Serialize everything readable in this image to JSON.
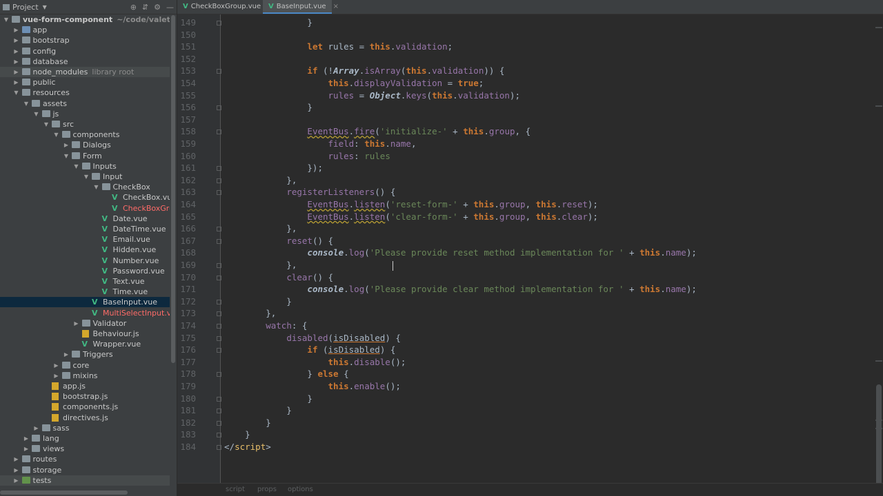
{
  "sidebar": {
    "title": "Project",
    "tree": [
      {
        "label": "vue-form-component",
        "sub": "~/code/valet/vue-fo",
        "depth": 0,
        "arrow": "down",
        "icon": "folder",
        "bold": true
      },
      {
        "label": "app",
        "depth": 1,
        "arrow": "right",
        "icon": "folder-blue"
      },
      {
        "label": "bootstrap",
        "depth": 1,
        "arrow": "right",
        "icon": "folder"
      },
      {
        "label": "config",
        "depth": 1,
        "arrow": "right",
        "icon": "folder"
      },
      {
        "label": "database",
        "depth": 1,
        "arrow": "right",
        "icon": "folder"
      },
      {
        "label": "node_modules",
        "sub": "library root",
        "depth": 1,
        "arrow": "right",
        "icon": "folder",
        "hl": true
      },
      {
        "label": "public",
        "depth": 1,
        "arrow": "right",
        "icon": "folder"
      },
      {
        "label": "resources",
        "depth": 1,
        "arrow": "down",
        "icon": "folder"
      },
      {
        "label": "assets",
        "depth": 2,
        "arrow": "down",
        "icon": "folder"
      },
      {
        "label": "js",
        "depth": 3,
        "arrow": "down",
        "icon": "folder"
      },
      {
        "label": "src",
        "depth": 4,
        "arrow": "down",
        "icon": "folder"
      },
      {
        "label": "components",
        "depth": 5,
        "arrow": "down",
        "icon": "folder"
      },
      {
        "label": "Dialogs",
        "depth": 6,
        "arrow": "right",
        "icon": "folder"
      },
      {
        "label": "Form",
        "depth": 6,
        "arrow": "down",
        "icon": "folder"
      },
      {
        "label": "Inputs",
        "depth": 7,
        "arrow": "down",
        "icon": "folder"
      },
      {
        "label": "Input",
        "depth": 8,
        "arrow": "down",
        "icon": "folder"
      },
      {
        "label": "CheckBox",
        "depth": 9,
        "arrow": "down",
        "icon": "folder"
      },
      {
        "label": "CheckBox.vue",
        "depth": 10,
        "icon": "vue"
      },
      {
        "label": "CheckBoxGro",
        "depth": 10,
        "icon": "vue",
        "red": true
      },
      {
        "label": "Date.vue",
        "depth": 9,
        "icon": "vue"
      },
      {
        "label": "DateTime.vue",
        "depth": 9,
        "icon": "vue"
      },
      {
        "label": "Email.vue",
        "depth": 9,
        "icon": "vue"
      },
      {
        "label": "Hidden.vue",
        "depth": 9,
        "icon": "vue"
      },
      {
        "label": "Number.vue",
        "depth": 9,
        "icon": "vue"
      },
      {
        "label": "Password.vue",
        "depth": 9,
        "icon": "vue"
      },
      {
        "label": "Text.vue",
        "depth": 9,
        "icon": "vue"
      },
      {
        "label": "Time.vue",
        "depth": 9,
        "icon": "vue"
      },
      {
        "label": "BaseInput.vue",
        "depth": 8,
        "icon": "vue",
        "selected": true
      },
      {
        "label": "MultiSelectInput.vue",
        "depth": 8,
        "icon": "vue",
        "red": true
      },
      {
        "label": "Validator",
        "depth": 7,
        "arrow": "right",
        "icon": "folder"
      },
      {
        "label": "Behaviour.js",
        "depth": 7,
        "icon": "js"
      },
      {
        "label": "Wrapper.vue",
        "depth": 7,
        "icon": "vue"
      },
      {
        "label": "Triggers",
        "depth": 6,
        "arrow": "right",
        "icon": "folder"
      },
      {
        "label": "core",
        "depth": 5,
        "arrow": "right",
        "icon": "folder"
      },
      {
        "label": "mixins",
        "depth": 5,
        "arrow": "right",
        "icon": "folder"
      },
      {
        "label": "app.js",
        "depth": 4,
        "icon": "js"
      },
      {
        "label": "bootstrap.js",
        "depth": 4,
        "icon": "js"
      },
      {
        "label": "components.js",
        "depth": 4,
        "icon": "js"
      },
      {
        "label": "directives.js",
        "depth": 4,
        "icon": "js"
      },
      {
        "label": "sass",
        "depth": 3,
        "arrow": "right",
        "icon": "folder"
      },
      {
        "label": "lang",
        "depth": 2,
        "arrow": "right",
        "icon": "folder"
      },
      {
        "label": "views",
        "depth": 2,
        "arrow": "right",
        "icon": "folder"
      },
      {
        "label": "routes",
        "depth": 1,
        "arrow": "right",
        "icon": "folder"
      },
      {
        "label": "storage",
        "depth": 1,
        "arrow": "right",
        "icon": "folder"
      },
      {
        "label": "tests",
        "depth": 1,
        "arrow": "right",
        "icon": "folder-green",
        "hl2": true
      }
    ]
  },
  "tabs": [
    {
      "label": "CheckBoxGroup.vue",
      "active": false
    },
    {
      "label": "BaseInput.vue",
      "active": true
    }
  ],
  "code": [
    {
      "n": "149",
      "t": [
        [
          "                }",
          "punc"
        ]
      ]
    },
    {
      "n": "150",
      "t": []
    },
    {
      "n": "151",
      "t": [
        [
          "                ",
          ""
        ],
        [
          "let",
          "kw"
        ],
        [
          " rules = ",
          ""
        ],
        [
          "this",
          "kw"
        ],
        [
          ".",
          ""
        ],
        [
          "validation",
          "prop"
        ],
        [
          ";",
          ""
        ]
      ]
    },
    {
      "n": "152",
      "t": []
    },
    {
      "n": "153",
      "t": [
        [
          "                ",
          ""
        ],
        [
          "if",
          "kw"
        ],
        [
          " (!",
          ""
        ],
        [
          "Array",
          "glob"
        ],
        [
          ".",
          ""
        ],
        [
          "isArray",
          "prop"
        ],
        [
          "(",
          ""
        ],
        [
          "this",
          "kw"
        ],
        [
          ".",
          ""
        ],
        [
          "validation",
          "prop"
        ],
        [
          ")) {",
          ""
        ]
      ]
    },
    {
      "n": "154",
      "t": [
        [
          "                    ",
          ""
        ],
        [
          "this",
          "kw"
        ],
        [
          ".",
          ""
        ],
        [
          "displayValidation",
          "prop"
        ],
        [
          " = ",
          ""
        ],
        [
          "true",
          "kw"
        ],
        [
          ";",
          ""
        ]
      ]
    },
    {
      "n": "155",
      "t": [
        [
          "                    ",
          ""
        ],
        [
          "rules",
          "prop"
        ],
        [
          " = ",
          ""
        ],
        [
          "Object",
          "glob"
        ],
        [
          ".",
          ""
        ],
        [
          "keys",
          "prop"
        ],
        [
          "(",
          ""
        ],
        [
          "this",
          "kw"
        ],
        [
          ".",
          ""
        ],
        [
          "validation",
          "prop"
        ],
        [
          ");",
          ""
        ]
      ]
    },
    {
      "n": "156",
      "t": [
        [
          "                }",
          ""
        ]
      ]
    },
    {
      "n": "157",
      "t": []
    },
    {
      "n": "158",
      "t": [
        [
          "                ",
          ""
        ],
        [
          "EventBus",
          "prop wave"
        ],
        [
          ".",
          ""
        ],
        [
          "fire",
          "prop wave"
        ],
        [
          "(",
          ""
        ],
        [
          "'initialize-'",
          "str"
        ],
        [
          " + ",
          ""
        ],
        [
          "this",
          "kw"
        ],
        [
          ".",
          ""
        ],
        [
          "group",
          "prop"
        ],
        [
          ", {",
          ""
        ]
      ]
    },
    {
      "n": "159",
      "t": [
        [
          "                    ",
          ""
        ],
        [
          "field",
          "prop"
        ],
        [
          ": ",
          ""
        ],
        [
          "this",
          "kw"
        ],
        [
          ".",
          ""
        ],
        [
          "name",
          "prop"
        ],
        [
          ",",
          ""
        ]
      ]
    },
    {
      "n": "160",
      "t": [
        [
          "                    ",
          ""
        ],
        [
          "rules",
          "prop"
        ],
        [
          ": ",
          ""
        ],
        [
          "rules",
          "str"
        ]
      ]
    },
    {
      "n": "161",
      "t": [
        [
          "                });",
          ""
        ]
      ]
    },
    {
      "n": "162",
      "t": [
        [
          "            },",
          ""
        ]
      ]
    },
    {
      "n": "163",
      "t": [
        [
          "            ",
          ""
        ],
        [
          "registerListeners",
          "prop"
        ],
        [
          "() {",
          ""
        ]
      ]
    },
    {
      "n": "164",
      "t": [
        [
          "                ",
          ""
        ],
        [
          "EventBus",
          "prop wave"
        ],
        [
          ".",
          ""
        ],
        [
          "listen",
          "prop wave"
        ],
        [
          "(",
          ""
        ],
        [
          "'reset-form-'",
          "str"
        ],
        [
          " + ",
          ""
        ],
        [
          "this",
          "kw"
        ],
        [
          ".",
          ""
        ],
        [
          "group",
          "prop"
        ],
        [
          ", ",
          ""
        ],
        [
          "this",
          "kw"
        ],
        [
          ".",
          ""
        ],
        [
          "reset",
          "prop"
        ],
        [
          ");",
          ""
        ]
      ]
    },
    {
      "n": "165",
      "t": [
        [
          "                ",
          ""
        ],
        [
          "EventBus",
          "prop wave"
        ],
        [
          ".",
          ""
        ],
        [
          "listen",
          "prop wave"
        ],
        [
          "(",
          ""
        ],
        [
          "'clear-form-'",
          "str"
        ],
        [
          " + ",
          ""
        ],
        [
          "this",
          "kw"
        ],
        [
          ".",
          ""
        ],
        [
          "group",
          "prop"
        ],
        [
          ", ",
          ""
        ],
        [
          "this",
          "kw"
        ],
        [
          ".",
          ""
        ],
        [
          "clear",
          "prop"
        ],
        [
          ");",
          ""
        ]
      ]
    },
    {
      "n": "166",
      "t": [
        [
          "            },",
          ""
        ]
      ]
    },
    {
      "n": "167",
      "t": [
        [
          "            ",
          ""
        ],
        [
          "reset",
          "prop"
        ],
        [
          "() {",
          ""
        ]
      ]
    },
    {
      "n": "168",
      "t": [
        [
          "                ",
          ""
        ],
        [
          "console",
          "glob"
        ],
        [
          ".",
          ""
        ],
        [
          "log",
          "prop"
        ],
        [
          "(",
          ""
        ],
        [
          "'Please provide reset method implementation for '",
          "str"
        ],
        [
          " + ",
          ""
        ],
        [
          "this",
          "kw"
        ],
        [
          ".",
          ""
        ],
        [
          "name",
          "prop"
        ],
        [
          ");",
          ""
        ]
      ]
    },
    {
      "n": "169",
      "t": [
        [
          "            },",
          ""
        ]
      ]
    },
    {
      "n": "170",
      "t": [
        [
          "            ",
          ""
        ],
        [
          "clear",
          "prop"
        ],
        [
          "() {",
          ""
        ]
      ]
    },
    {
      "n": "171",
      "t": [
        [
          "                ",
          ""
        ],
        [
          "console",
          "glob"
        ],
        [
          ".",
          ""
        ],
        [
          "log",
          "prop"
        ],
        [
          "(",
          ""
        ],
        [
          "'Please provide clear method implementation for '",
          "str"
        ],
        [
          " + ",
          ""
        ],
        [
          "this",
          "kw"
        ],
        [
          ".",
          ""
        ],
        [
          "name",
          "prop"
        ],
        [
          ");",
          ""
        ]
      ]
    },
    {
      "n": "172",
      "t": [
        [
          "            }",
          ""
        ]
      ]
    },
    {
      "n": "173",
      "t": [
        [
          "        },",
          ""
        ]
      ]
    },
    {
      "n": "174",
      "t": [
        [
          "        ",
          ""
        ],
        [
          "watch",
          "prop"
        ],
        [
          ": {",
          ""
        ]
      ]
    },
    {
      "n": "175",
      "t": [
        [
          "            ",
          ""
        ],
        [
          "disabled",
          "prop"
        ],
        [
          "(",
          ""
        ],
        [
          "isDisabled",
          "und"
        ],
        [
          ") {",
          ""
        ]
      ]
    },
    {
      "n": "176",
      "t": [
        [
          "                ",
          ""
        ],
        [
          "if",
          "kw"
        ],
        [
          " (",
          ""
        ],
        [
          "isDisabled",
          "und"
        ],
        [
          ") {",
          ""
        ]
      ]
    },
    {
      "n": "177",
      "t": [
        [
          "                    ",
          ""
        ],
        [
          "this",
          "kw"
        ],
        [
          ".",
          ""
        ],
        [
          "disable",
          "prop"
        ],
        [
          "();",
          ""
        ]
      ]
    },
    {
      "n": "178",
      "t": [
        [
          "                } ",
          ""
        ],
        [
          "else",
          "kw"
        ],
        [
          " {",
          ""
        ]
      ]
    },
    {
      "n": "179",
      "t": [
        [
          "                    ",
          ""
        ],
        [
          "this",
          "kw"
        ],
        [
          ".",
          ""
        ],
        [
          "enable",
          "prop"
        ],
        [
          "();",
          ""
        ]
      ]
    },
    {
      "n": "180",
      "t": [
        [
          "                }",
          ""
        ]
      ]
    },
    {
      "n": "181",
      "t": [
        [
          "            }",
          ""
        ]
      ]
    },
    {
      "n": "182",
      "t": [
        [
          "        }",
          ""
        ]
      ]
    },
    {
      "n": "183",
      "t": [
        [
          "    }",
          ""
        ]
      ]
    },
    {
      "n": "184",
      "t": [
        [
          "</",
          "punc"
        ],
        [
          "script",
          "tag"
        ],
        [
          ">",
          "punc"
        ]
      ]
    }
  ],
  "status": {
    "breadcrumb": [
      "script",
      "props",
      "options"
    ]
  }
}
